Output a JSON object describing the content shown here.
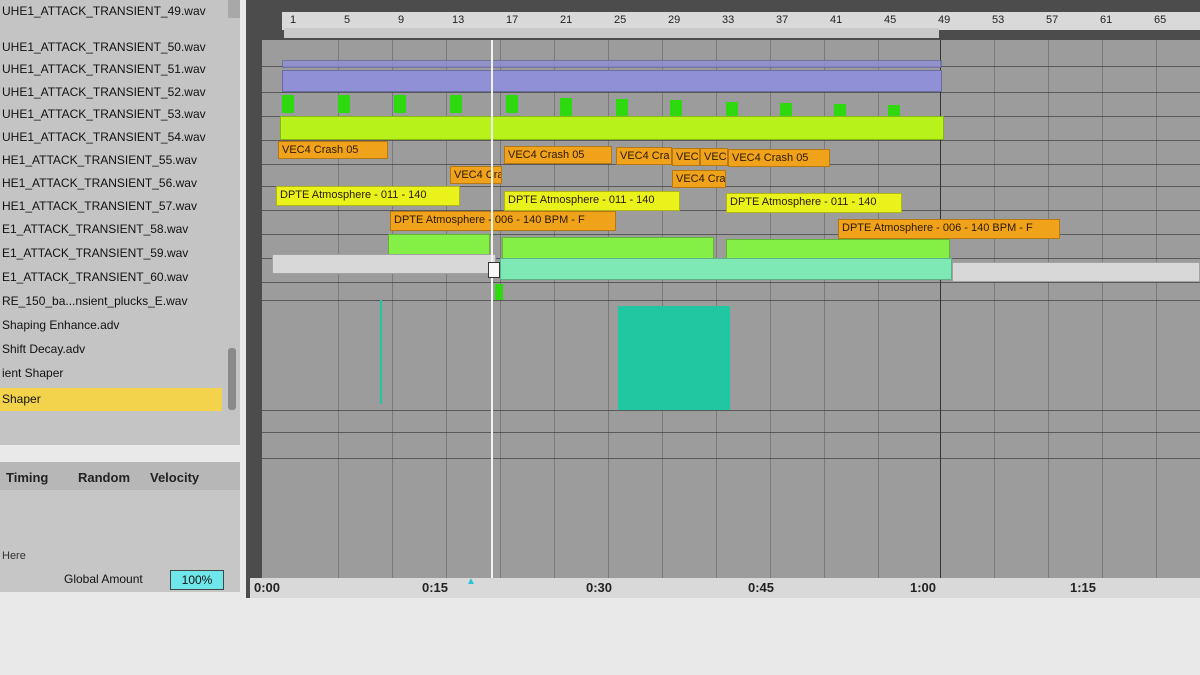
{
  "browser": {
    "items": [
      {
        "label": "UHE1_ATTACK_TRANSIENT_49.wav"
      },
      {
        "label": "UHE1_ATTACK_TRANSIENT_50.wav"
      },
      {
        "label": "UHE1_ATTACK_TRANSIENT_51.wav"
      },
      {
        "label": "UHE1_ATTACK_TRANSIENT_52.wav"
      },
      {
        "label": "UHE1_ATTACK_TRANSIENT_53.wav"
      },
      {
        "label": "UHE1_ATTACK_TRANSIENT_54.wav"
      },
      {
        "label": "HE1_ATTACK_TRANSIENT_55.wav"
      },
      {
        "label": "HE1_ATTACK_TRANSIENT_56.wav"
      },
      {
        "label": "HE1_ATTACK_TRANSIENT_57.wav"
      },
      {
        "label": "E1_ATTACK_TRANSIENT_58.wav"
      },
      {
        "label": "E1_ATTACK_TRANSIENT_59.wav"
      },
      {
        "label": "E1_ATTACK_TRANSIENT_60.wav"
      },
      {
        "label": "RE_150_ba...nsient_plucks_E.wav"
      },
      {
        "label": "Shaping Enhance.adv"
      },
      {
        "label": "Shift Decay.adv"
      },
      {
        "label": "ient Shaper"
      },
      {
        "label": "Shaper",
        "selected": true
      }
    ]
  },
  "groove": {
    "col_timing": "Timing",
    "col_random": "Random",
    "col_velocity": "Velocity",
    "drop_hint": "Here",
    "global_amount_label": "Global Amount",
    "global_amount_value": "100%"
  },
  "ruler": {
    "bars": [
      "1",
      "5",
      "9",
      "13",
      "17",
      "21",
      "25",
      "29",
      "33",
      "37",
      "41",
      "45",
      "49",
      "53",
      "57",
      "61",
      "65"
    ]
  },
  "timeline": {
    "labels": [
      "0:00",
      "0:15",
      "0:30",
      "0:45",
      "1:00",
      "1:15"
    ]
  },
  "clips": {
    "crash_a": "VEC4 Crash 05",
    "crash_b": "VEC4 Crash 05",
    "crash_c": "VEC4 Cra",
    "crash_d": "VEC",
    "crash_e": "VEC",
    "crash_f": "VEC4 Crash 05",
    "crash_g": "VEC4 Cra",
    "crash_h": "VEC4 Cra",
    "atmos_a": "DPTE Atmosphere - 011 - 140",
    "atmos_b": "DPTE Atmosphere - 011 - 140",
    "atmos_c": "DPTE Atmosphere - 011 - 140",
    "atmos_d": "DPTE Atmosphere - 006 - 140 BPM - F",
    "atmos_e": "DPTE Atmosphere - 006 - 140 BPM - F"
  },
  "colors": {
    "selection": "#f2d34b",
    "orange_clip": "#f0a21b",
    "yellow_clip": "#eaf21b",
    "lime_clip": "#b7f21b",
    "green_clip": "#84f045",
    "lavender_clip": "#8f90d6",
    "automation": "#20c7a0",
    "global_amount_field": "#6fe7ea"
  }
}
